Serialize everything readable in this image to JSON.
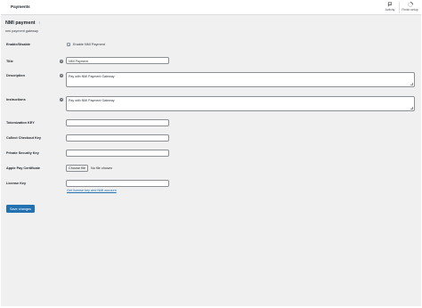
{
  "topbar": {
    "title": "Payments",
    "activity_label": "Activity",
    "finish_label": "Finish setup"
  },
  "page": {
    "title": "NMI payment",
    "up_arrow": "↑",
    "subtitle": "nmi payment gateway"
  },
  "form": {
    "enable": {
      "label": "Enable/Disable",
      "checkbox_label": "Enable NMI Payment",
      "checked": true
    },
    "title": {
      "label": "Title",
      "value": "NMI Payment"
    },
    "description": {
      "label": "Description",
      "value": "Pay with NMI Payment Gateway"
    },
    "instructions": {
      "label": "Instructions",
      "value": "Pay with NMI Payment Gateway"
    },
    "tokenization_key": {
      "label": "Tokenization KEY",
      "value": ""
    },
    "collect_checkout_key": {
      "label": "Collect Checkout Key",
      "value": ""
    },
    "private_security_key": {
      "label": "Private Security Key",
      "value": ""
    },
    "apple_pay_certificate": {
      "label": "Apple Pay Certificate",
      "button_label": "Choose file",
      "status": "No file chosen"
    },
    "license_key": {
      "label": "License Key",
      "value": "",
      "link_text": "Get license key and NMI account"
    },
    "save_label": "Save changes"
  },
  "colors": {
    "accent": "#2271b1",
    "background": "#f0f0f1"
  },
  "icons": {
    "activity": "flag-icon",
    "finish": "progress-circle-icon",
    "help": "help-icon"
  }
}
